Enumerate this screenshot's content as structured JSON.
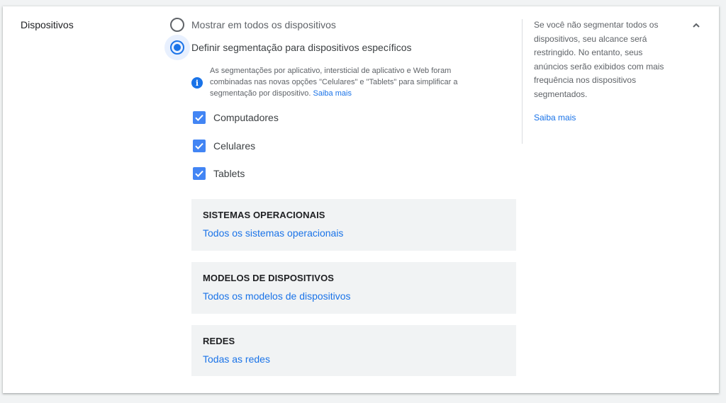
{
  "section": {
    "title": "Dispositivos"
  },
  "radios": [
    {
      "label": "Mostrar em todos os dispositivos",
      "checked": false
    },
    {
      "label": "Definir segmentação para dispositivos específicos",
      "checked": true
    }
  ],
  "info": {
    "text": "As segmentações por aplicativo, intersticial de aplicativo e Web foram combinadas nas novas opções \"Celulares\" e \"Tablets\" para simplificar a segmentação por dispositivo.",
    "link": "Saiba mais",
    "icon": "info-icon"
  },
  "devices": [
    {
      "label": "Computadores",
      "checked": true
    },
    {
      "label": "Celulares",
      "checked": true
    },
    {
      "label": "Tablets",
      "checked": true
    }
  ],
  "panels": [
    {
      "title": "SISTEMAS OPERACIONAIS",
      "value": "Todos os sistemas operacionais"
    },
    {
      "title": "MODELOS DE DISPOSITIVOS",
      "value": "Todos os modelos de dispositivos"
    },
    {
      "title": "REDES",
      "value": "Todas as redes"
    }
  ],
  "help": {
    "text": "Se você não segmentar todos os dispositivos, seu alcance será restringido. No entanto, seus anúncios serão exibidos com mais frequência nos dispositivos segmentados.",
    "link": "Saiba mais"
  },
  "colors": {
    "accent": "#1a73e8",
    "checkbox": "#4285f4",
    "panel_bg": "#f1f3f4"
  }
}
